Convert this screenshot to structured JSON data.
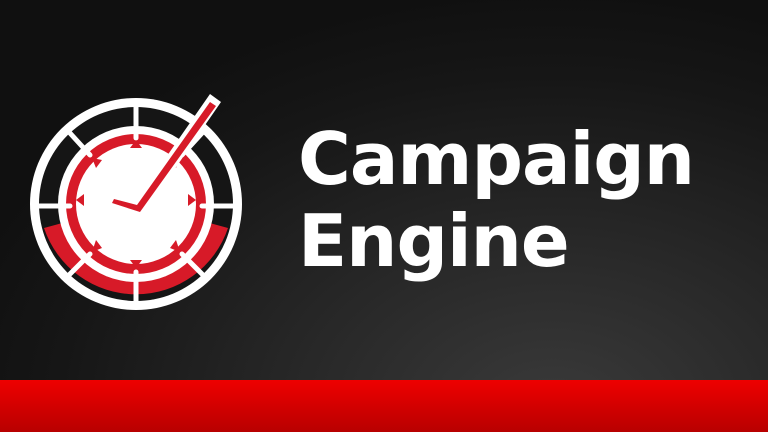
{
  "brand": {
    "name_line_1": "Campaign",
    "name_line_2": "Engine",
    "logo_icon": "gauge-checkmark-icon"
  },
  "colors": {
    "background_dark": "#111111",
    "background_light": "#3a3a3a",
    "accent_red": "#d71a28",
    "stripe_red": "#ee0000",
    "stripe_red_dark": "#b80000",
    "text": "#ffffff"
  }
}
